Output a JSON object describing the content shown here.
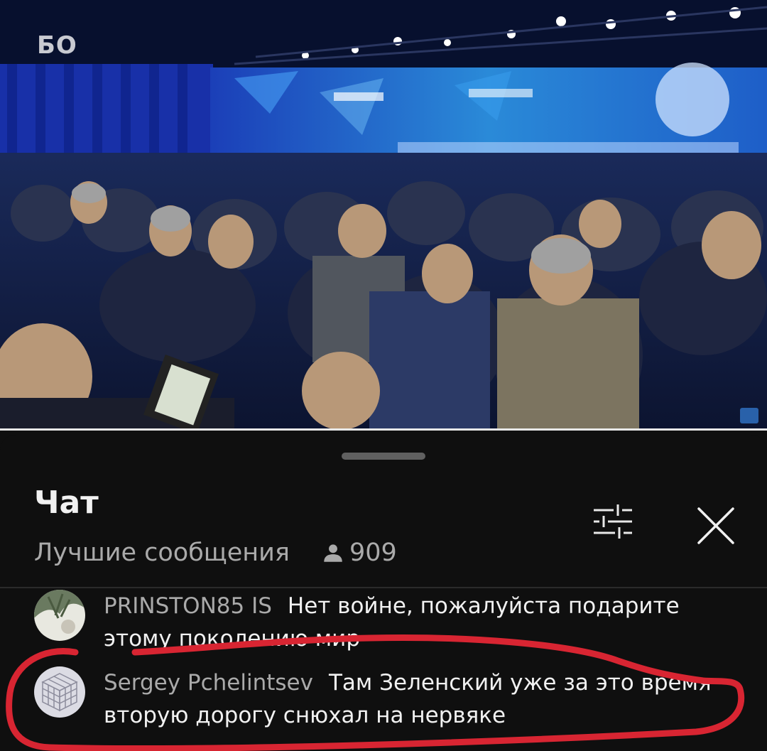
{
  "video": {
    "watermark": "БО",
    "progress_fraction": 1.0
  },
  "chat": {
    "title": "Чат",
    "mode_label": "Лучшие сообщения",
    "viewer_count": "909",
    "filter_icon": "tune-icon",
    "close_icon": "close-icon"
  },
  "messages": [
    {
      "author": "PRINSTON85 IS",
      "text": "Нет войне, пожалуйста подарите этому поколению мир",
      "avatar": "avatar-photo"
    },
    {
      "author": "Sergey Pchelintsev",
      "text": "Там Зеленский уже за это время вторую дорогу снюхал на нервяке",
      "avatar": "avatar-cube"
    }
  ],
  "colors": {
    "panel_bg": "#0f0f0f",
    "author": "#aaaaaa",
    "text": "#f1f1f1",
    "annotation_red": "#d82532"
  }
}
